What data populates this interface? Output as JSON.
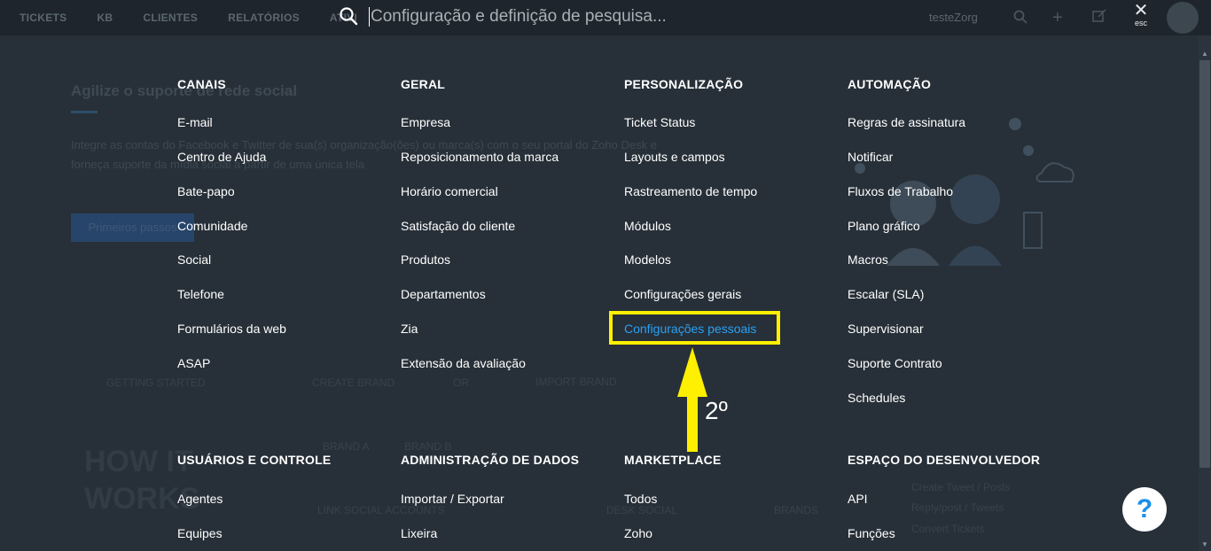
{
  "topnav": {
    "items": [
      "TICKETS",
      "KB",
      "CLIENTES",
      "RELATÓRIOS",
      "ATIVI"
    ],
    "user_name": "testeZorg"
  },
  "background": {
    "heading": "Agilize o suporte de rede social",
    "text_line1": "Integre as contas do Facebook e Twitter de sua(s) organização(ões) ou marca(s) com o seu portal do Zoho Desk e",
    "text_line2": "forneça suporte da mídia social a partir de uma única tela",
    "button": "Primeiros passos",
    "how_it_works": "HOW IT WORKS",
    "getting_started": "GETTING STARTED",
    "create_brand": "CREATE BRAND",
    "or": "OR",
    "import_brand": "IMPORT BRAND",
    "brand_a": "BRAND A",
    "brand_b": "BRAND B",
    "link_social": "LINK SOCIAL ACCOUNTS",
    "desk_social": "DESK SOCIAL",
    "brands": "BRANDS",
    "right_text1": "Create Tweet / Posts",
    "right_text2": "Reply/post / Tweets",
    "right_text3": "Convert Tickets"
  },
  "search": {
    "placeholder": "Configuração e definição de pesquisa..."
  },
  "close": {
    "x": "✕",
    "esc": "esc"
  },
  "sections_top": [
    {
      "title": "CANAIS",
      "items": [
        "E-mail",
        "Centro de Ajuda",
        "Bate-papo",
        "Comunidade",
        "Social",
        "Telefone",
        "Formulários da web",
        "ASAP"
      ]
    },
    {
      "title": "GERAL",
      "items": [
        "Empresa",
        "Reposicionamento da marca",
        "Horário comercial",
        "Satisfação do cliente",
        "Produtos",
        "Departamentos",
        "Zia",
        "Extensão da avaliação"
      ]
    },
    {
      "title": "PERSONALIZAÇÃO",
      "items": [
        "Ticket Status",
        "Layouts e campos",
        "Rastreamento de tempo",
        "Módulos",
        "Modelos",
        "Configurações gerais",
        "Configurações pessoais"
      ]
    },
    {
      "title": "AUTOMAÇÃO",
      "items": [
        "Regras de assinatura",
        "Notificar",
        "Fluxos de Trabalho",
        "Plano gráfico",
        "Macros",
        "Escalar (SLA)",
        "Supervisionar",
        "Suporte Contrato",
        "Schedules"
      ]
    }
  ],
  "sections_bottom": [
    {
      "title": "USUÁRIOS E CONTROLE",
      "items": [
        "Agentes",
        "Equipes"
      ]
    },
    {
      "title": "ADMINISTRAÇÃO DE DADOS",
      "items": [
        "Importar / Exportar",
        "Lixeira"
      ]
    },
    {
      "title": "MARKETPLACE",
      "items": [
        "Todos",
        "Zoho"
      ]
    },
    {
      "title": "ESPAÇO DO DESENVOLVEDOR",
      "items": [
        "API",
        "Funções"
      ]
    }
  ],
  "annotation": {
    "label": "2º",
    "highlight_color": "#ffef00"
  },
  "colors": {
    "overlay": "#273038",
    "active_link": "#2aa0f5"
  },
  "help": {
    "label": "?"
  }
}
